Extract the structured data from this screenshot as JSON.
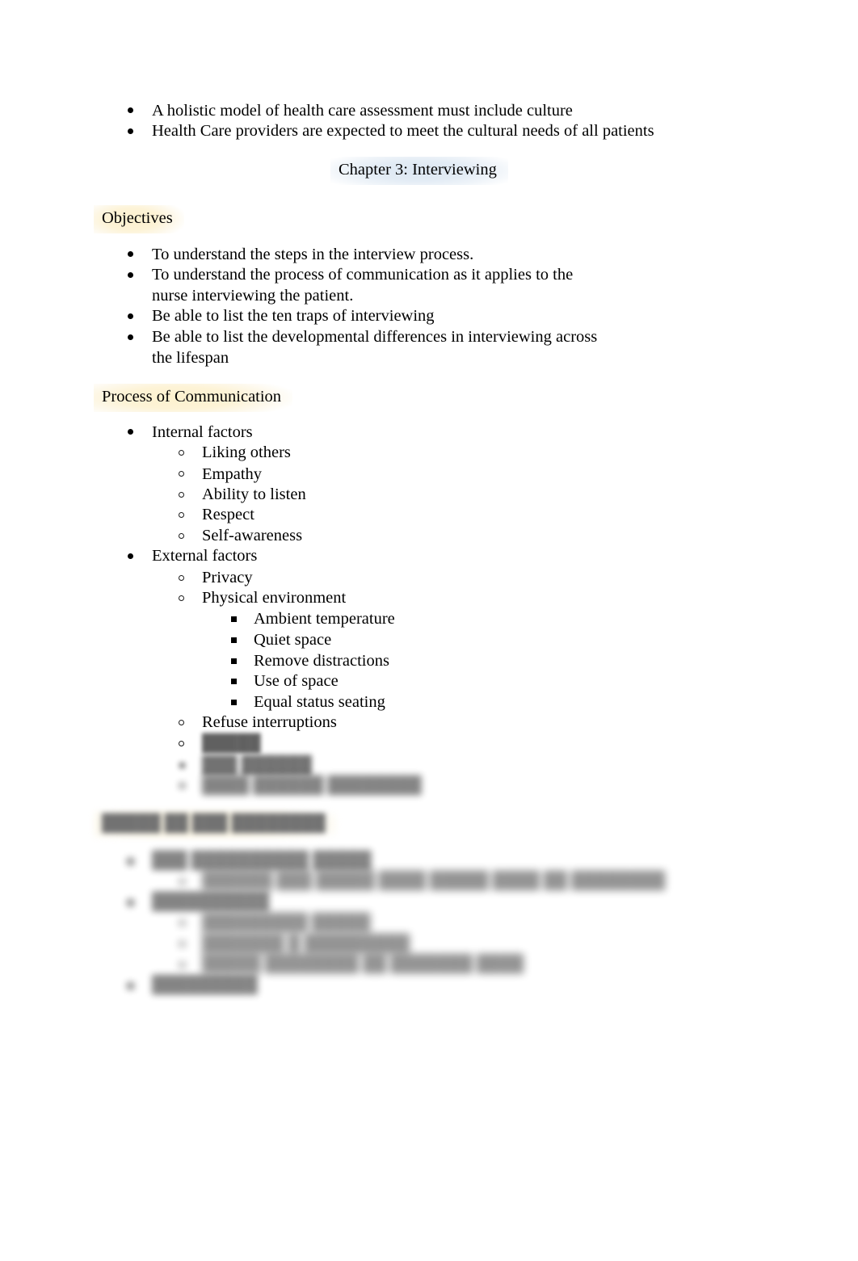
{
  "document": {
    "type": "study-notes",
    "page_background": "#ffffff",
    "text_color": "#000000",
    "highlight_yellow": "#fdf1ce",
    "highlight_blue": "#dce7f2"
  },
  "intro_bullets": [
    "A holistic model of health care assessment must include culture",
    "Health Care providers are expected to meet the cultural needs of all patients"
  ],
  "chapter_title": "Chapter 3: Interviewing",
  "sections": {
    "objectives": {
      "heading": "Objectives",
      "items": [
        "To understand the steps in the interview process.",
        "To understand the process of communication as it applies to the nurse interviewing the patient.",
        "Be able to list the ten traps of interviewing",
        "Be able to list the developmental differences in interviewing across the lifespan"
      ]
    },
    "process_of_communication": {
      "heading": "Process of Communication",
      "internal": {
        "label": "Internal factors",
        "items": [
          "Liking others",
          "Empathy",
          "Ability to listen",
          "Respect",
          "Self-awareness"
        ]
      },
      "external": {
        "label": "External factors",
        "items": [
          "Privacy",
          "Physical environment",
          "Refuse interruptions"
        ],
        "physical_environment_items": [
          "Ambient temperature",
          "Quiet space",
          "Remove distractions",
          "Use of space",
          "Equal status seating"
        ]
      },
      "obscured_items": [
        "█████",
        "███ ██████",
        "████ ██████ ████████"
      ]
    },
    "obscured_section": {
      "heading": "█████ ██ ███ ████████",
      "items": [
        {
          "label": "███ ██████████ █████",
          "subitems": [
            "██████ ███ █████ ████ █████ ████ ██ ████████"
          ]
        },
        {
          "label": "██████████",
          "subitems": [
            "█████████ █████",
            "███████ █ █████████",
            "█████ ████████ ██ ███████ ████"
          ]
        },
        {
          "label": "█████████",
          "subitems": []
        }
      ]
    }
  }
}
